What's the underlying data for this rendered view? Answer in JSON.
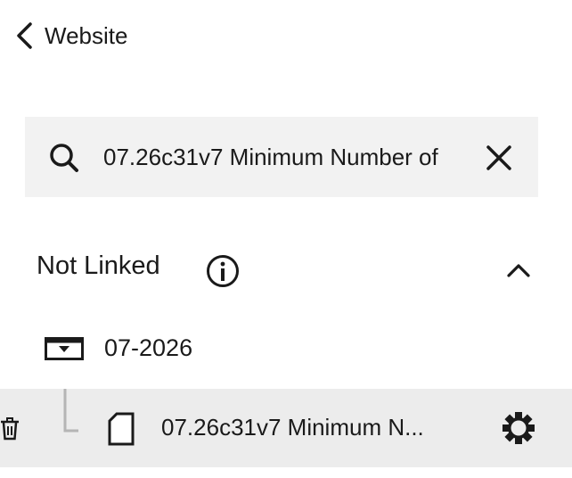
{
  "header": {
    "back_label": "Website"
  },
  "search": {
    "value": "07.26c31v7 Minimum Number of",
    "icon": "search-icon",
    "clear_icon": "close-icon"
  },
  "section": {
    "title": "Not Linked",
    "info_icon": "info-icon",
    "collapse_icon": "chevron-up-icon"
  },
  "folder": {
    "label": "07-2026",
    "icon": "folder-dropdown-icon"
  },
  "item": {
    "label": "07.26c31v7 Minimum N...",
    "icon": "document-icon",
    "settings_icon": "gear-icon",
    "delete_icon": "trash-icon"
  },
  "colors": {
    "search_background": "#f2f2f2",
    "selected_row_background": "#ececec",
    "text": "#1a1a1a"
  }
}
